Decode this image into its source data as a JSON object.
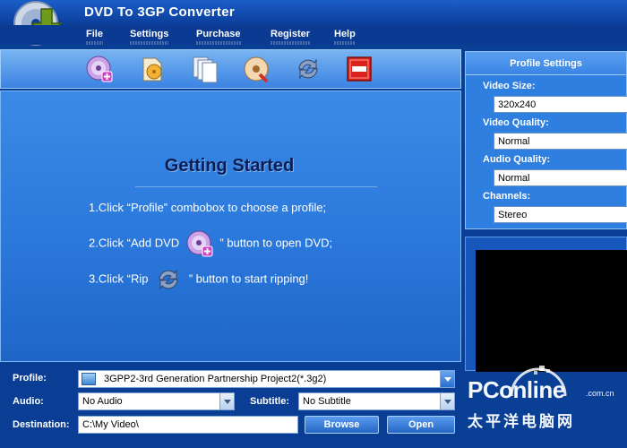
{
  "window": {
    "title": "DVD To 3GP Converter"
  },
  "menu": {
    "items": [
      "File",
      "Settings",
      "Purchase",
      "Register",
      "Help"
    ]
  },
  "toolbar": {
    "icons": [
      "add-dvd-icon",
      "open-file-icon",
      "copy-pages-icon",
      "snapshot-icon",
      "rip-icon",
      "stop-icon"
    ]
  },
  "getting_started": {
    "title": "Getting Started",
    "step1": "1.Click “Profile” combobox to choose a profile;",
    "step2_pre": "2.Click “Add DVD",
    "step2_post": "” button to open DVD;",
    "step3_pre": "3.Click “Rip",
    "step3_post": "” button to start ripping!"
  },
  "profile_settings": {
    "header": "Profile Settings",
    "video_size_label": "Video Size:",
    "video_size_value": "320x240",
    "video_quality_label": "Video Quality:",
    "video_quality_value": "Normal",
    "audio_quality_label": "Audio Quality:",
    "audio_quality_value": "Normal",
    "channels_label": "Channels:",
    "channels_value": "Stereo"
  },
  "bottom": {
    "profile_label": "Profile:",
    "profile_value": "3GPP2-3rd Generation Partnership Project2(*.3g2)",
    "audio_label": "Audio:",
    "audio_value": "No Audio",
    "subtitle_label": "Subtitle:",
    "subtitle_value": "No Subtitle",
    "destination_label": "Destination:",
    "destination_value": "C:\\My Video\\",
    "browse_label": "Browse",
    "open_label": "Open"
  },
  "watermark": {
    "brand": "PConline",
    "domain": ".com.cn",
    "chinese": "太平洋电脑网"
  }
}
